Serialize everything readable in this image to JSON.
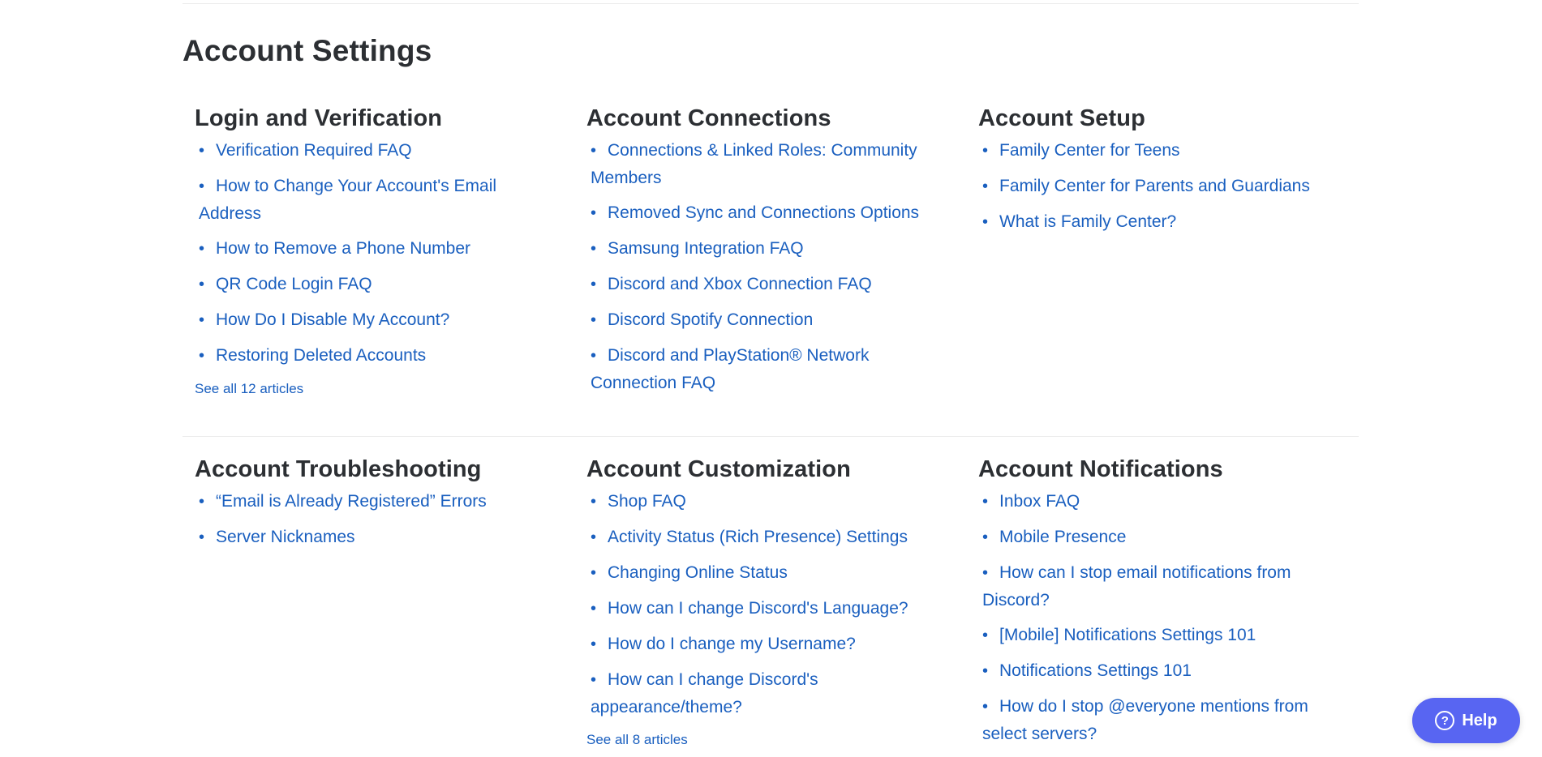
{
  "section": {
    "title": "Account Settings"
  },
  "categories": [
    {
      "title": "Login and Verification",
      "articles": [
        "Verification Required FAQ",
        "How to Change Your Account's Email Address",
        "How to Remove a Phone Number",
        "QR Code Login FAQ",
        "How Do I Disable My Account?",
        "Restoring Deleted Accounts"
      ],
      "see_all": "See all 12 articles"
    },
    {
      "title": "Account Connections",
      "articles": [
        "Connections & Linked Roles: Community Members",
        "Removed Sync and Connections Options",
        "Samsung Integration FAQ",
        "Discord and Xbox Connection FAQ",
        "Discord Spotify Connection",
        "Discord and PlayStation® Network Connection FAQ"
      ],
      "see_all": ""
    },
    {
      "title": "Account Setup",
      "articles": [
        "Family Center for Teens",
        "Family Center for Parents and Guardians",
        "What is Family Center?"
      ],
      "see_all": ""
    },
    {
      "title": "Account Troubleshooting",
      "articles": [
        "“Email is Already Registered” Errors",
        "Server Nicknames"
      ],
      "see_all": ""
    },
    {
      "title": "Account Customization",
      "articles": [
        "Shop FAQ",
        "Activity Status (Rich Presence) Settings",
        "Changing Online Status",
        "How can I change Discord's Language?",
        "How do I change my Username?",
        "How can I change Discord's appearance/theme?"
      ],
      "see_all": "See all 8 articles"
    },
    {
      "title": "Account Notifications",
      "articles": [
        "Inbox FAQ",
        "Mobile Presence",
        "How can I stop email notifications from Discord?",
        "[Mobile] Notifications Settings 101",
        "Notifications Settings 101",
        "How do I stop @everyone mentions from select servers?"
      ],
      "see_all": ""
    }
  ],
  "help_button": {
    "label": "Help",
    "icon": "question-circle-icon"
  },
  "colors": {
    "link": "#1a5fbf",
    "heading": "#2c2f33",
    "help_bg": "#5865f2"
  }
}
